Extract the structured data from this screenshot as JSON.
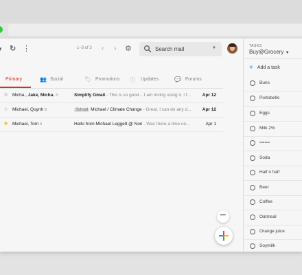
{
  "colors": {
    "accent_red": "#d93025",
    "star_gold": "#f4b400",
    "link_blue": "#1a73e8"
  },
  "toolbar": {
    "refresh_icon": "refresh-icon",
    "more_icon": "more-vert-icon",
    "page_count": "1–3 of 3",
    "settings_icon": "gear-icon"
  },
  "search": {
    "placeholder": "Search mail"
  },
  "tabs": [
    {
      "label": "Primary",
      "icon": "inbox-icon",
      "active": true
    },
    {
      "label": "Social",
      "icon": "people-icon"
    },
    {
      "label": "Promotions",
      "icon": "tag-icon"
    },
    {
      "label": "Updates",
      "icon": "info-icon"
    },
    {
      "label": "Forums",
      "icon": "forum-icon"
    }
  ],
  "emails": [
    {
      "from_prefix": "Micha., ",
      "from_bold": "Jake, Micha.",
      "count": "3",
      "starred": false,
      "subject": "Simplify Gmail",
      "snippet": " - This is so good... I am loving using it. I f...",
      "label": "",
      "date": "Apr 12"
    },
    {
      "from_prefix": "Michael, Quynh",
      "from_bold": "",
      "count": "8",
      "starred": false,
      "subject": "Michael / Climate Change",
      "snippet": " - Great. I can do any d...",
      "label": "School",
      "date": "Apr 12"
    },
    {
      "from_prefix": "Michael, Tom",
      "from_bold": "",
      "count": "4",
      "starred": true,
      "subject": "Hello from Michael Leggett @ Nori",
      "snippet": " - Was there a time on...",
      "label": "",
      "date": "Apr 1"
    }
  ],
  "fab": {
    "more_label": "•••"
  },
  "tasks": {
    "caption": "TASKS",
    "list_name": "Buy@Grocery",
    "add_label": "Add a task",
    "items": [
      "Buns",
      "Portobello",
      "Eggs",
      "Milk 2%",
      "====",
      "Soda",
      "Half n half",
      "Beer",
      "Coffee",
      "Oatmeal",
      "Orange juice",
      "Soymilk"
    ]
  }
}
